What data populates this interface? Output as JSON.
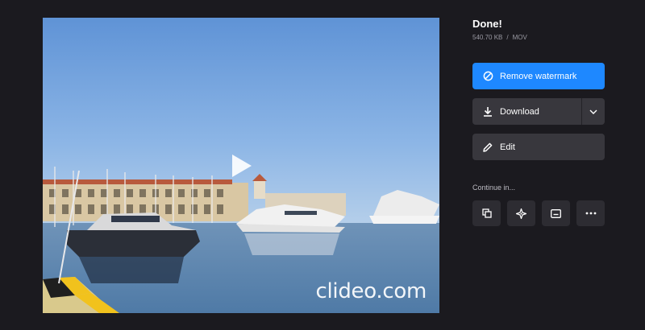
{
  "video": {
    "watermark": "clideo.com",
    "icons": {
      "play": "play-icon"
    }
  },
  "result": {
    "title": "Done!",
    "file_size": "540.70 KB",
    "separator": "/",
    "file_format": "MOV"
  },
  "actions": {
    "remove_watermark": {
      "label": "Remove watermark",
      "icon": "no-watermark-icon",
      "color": "#1e88ff"
    },
    "download": {
      "label": "Download",
      "icon": "download-icon",
      "dropdown_icon": "chevron-down-icon"
    },
    "edit": {
      "label": "Edit",
      "icon": "pencil-icon"
    }
  },
  "continue": {
    "label": "Continue in...",
    "tools": [
      {
        "name": "layers-icon"
      },
      {
        "name": "sparkle-icon"
      },
      {
        "name": "subtitles-icon"
      },
      {
        "name": "more-icon"
      }
    ]
  },
  "colors": {
    "background": "#1b1a1f",
    "button": "#38373d",
    "accent": "#1e88ff"
  }
}
